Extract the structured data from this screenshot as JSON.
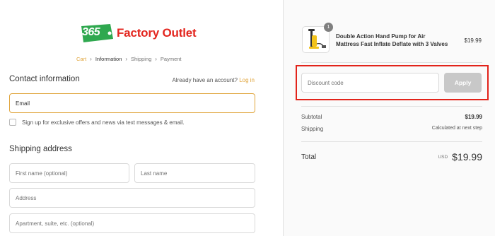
{
  "brand": {
    "logo_number": "365",
    "logo_text": "Factory Outlet",
    "colors": {
      "green": "#2fa84f",
      "red": "#e3261f",
      "accent": "#e0a43a"
    }
  },
  "breadcrumb": [
    "Cart",
    "Information",
    "Shipping",
    "Payment"
  ],
  "contact": {
    "title": "Contact information",
    "account_prompt": "Already have an account?",
    "login_link": "Log in",
    "email_placeholder": "Email",
    "marketing_label": "Sign up for exclusive offers and news via text messages & email."
  },
  "shipping": {
    "title": "Shipping address",
    "first_name_placeholder": "First name (optional)",
    "last_name_placeholder": "Last name",
    "address_placeholder": "Address",
    "apartment_placeholder": "Apartment, suite, etc. (optional)"
  },
  "order": {
    "item": {
      "quantity": "1",
      "name": "Double Action Hand Pump for Air Mattress Fast Inflate Deflate with 3 Valves",
      "price": "$19.99"
    },
    "discount_placeholder": "Discount code",
    "apply_label": "Apply",
    "subtotal_label": "Subtotal",
    "subtotal_value": "$19.99",
    "shipping_label": "Shipping",
    "shipping_value": "Calculated at next step",
    "total_label": "Total",
    "currency": "USD",
    "total_value": "$19.99"
  }
}
